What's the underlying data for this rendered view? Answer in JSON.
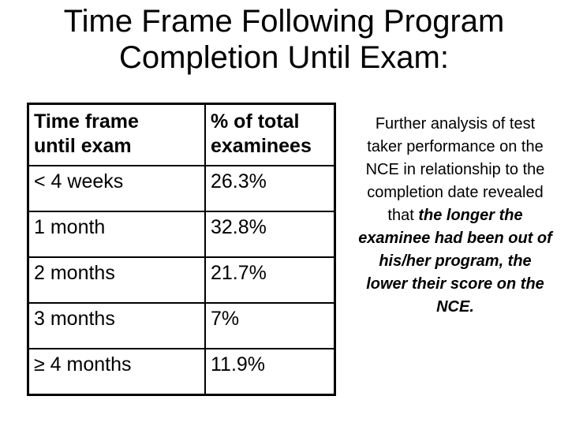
{
  "title": {
    "line1": "Time Frame Following Program",
    "line2": "Completion Until Exam:"
  },
  "table": {
    "headers": [
      "Time frame until exam",
      "% of total examinees"
    ],
    "header_lines": [
      [
        "Time frame",
        "until exam"
      ],
      [
        "% of total",
        "examinees"
      ]
    ],
    "rows": [
      {
        "time_frame": "< 4 weeks",
        "percent": "26.3%"
      },
      {
        "time_frame": "1 month",
        "percent": "32.8%"
      },
      {
        "time_frame": "2 months",
        "percent": "21.7%"
      },
      {
        "time_frame": "3 months",
        "percent": "7%"
      },
      {
        "time_frame": "≥ 4 months",
        "percent": "11.9%"
      }
    ]
  },
  "side_note": {
    "plain": "Further analysis of test taker performance on the NCE in relationship to the completion date revealed that",
    "emphasis": "the longer the examinee had been out of his/her program, the lower their score on the NCE."
  }
}
